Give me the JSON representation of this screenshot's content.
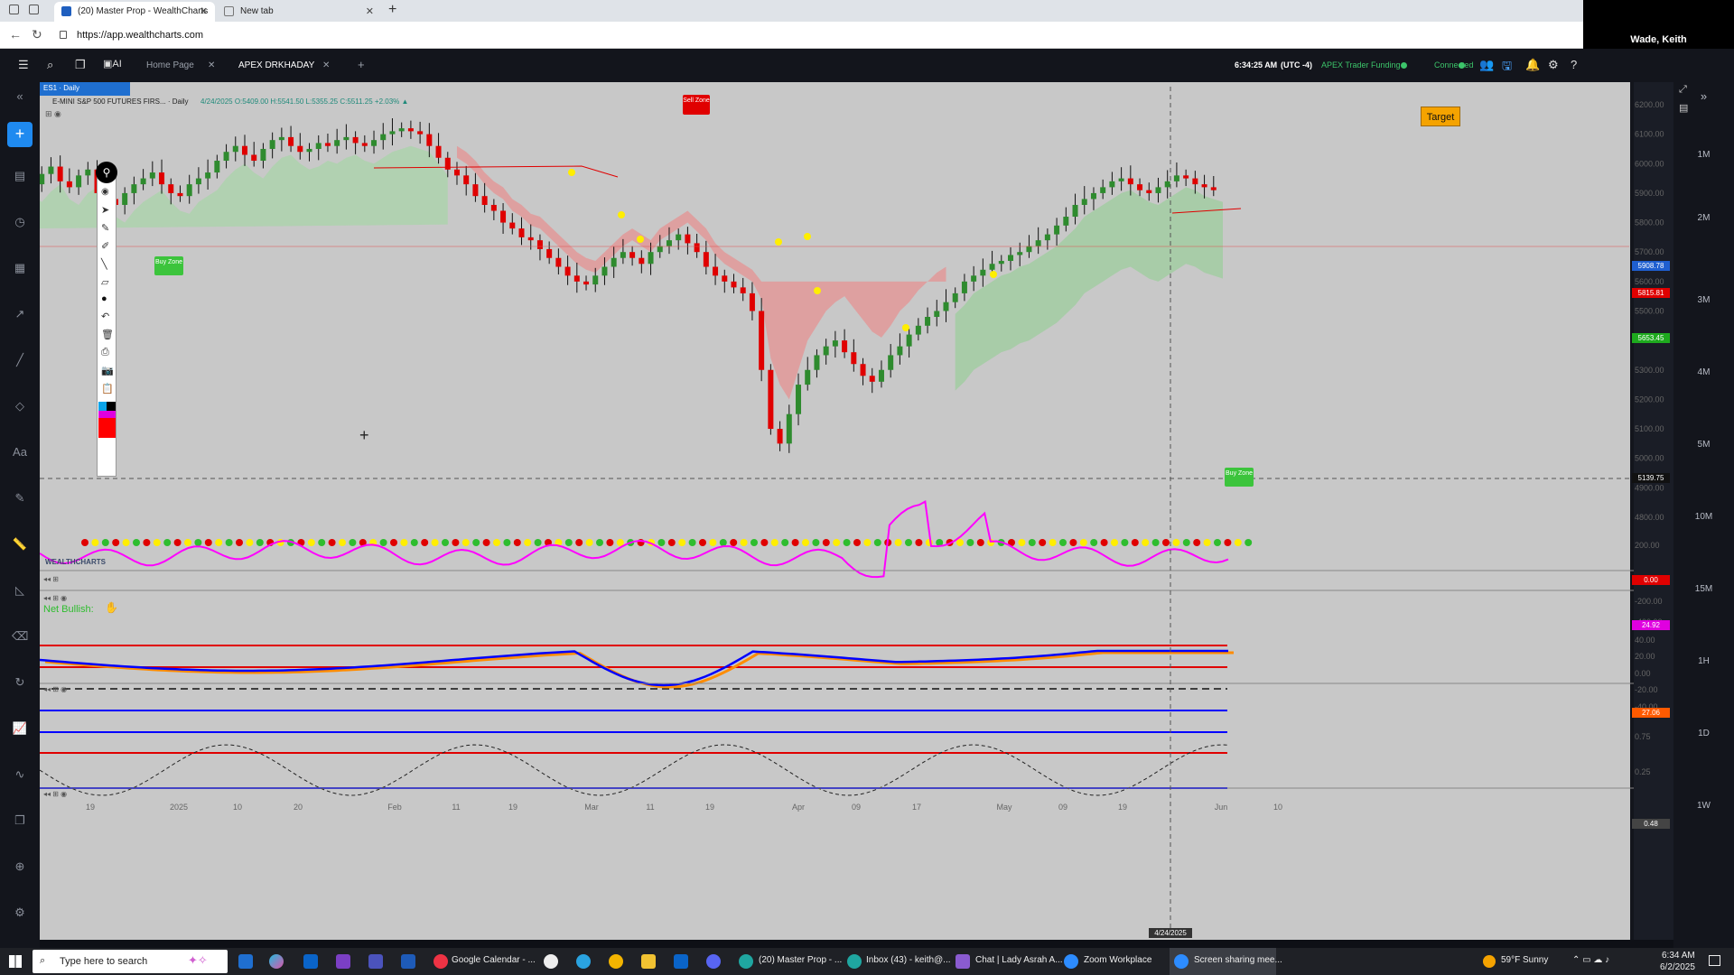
{
  "browser": {
    "tabs": [
      {
        "label": "(20) Master Prop - WealthCharts"
      },
      {
        "label": "New tab"
      }
    ],
    "url": "https://app.wealthcharts.com"
  },
  "zoom": {
    "participant": "Wade, Keith"
  },
  "app": {
    "tabs": [
      {
        "label": "Home Page"
      },
      {
        "label": "APEX DRKHADAY"
      }
    ],
    "clock": "6:34:25 AM",
    "timezone": "(UTC -4)",
    "account": "APEX Trader Funding",
    "connection": "Connected",
    "right_timeframes": [
      "1M",
      "2M",
      "3M",
      "4M",
      "5M",
      "10M",
      "15M",
      "1H",
      "1D",
      "1W"
    ]
  },
  "chart": {
    "symbol_badge": "ES1 · Daily",
    "instrument": "E-MINI S&P 500 FUTURES FIRS... · Daily",
    "ohlc": "4/24/2025 O:5409.00 H:5541.50 L:5355.25 C:5511.25 +2.03% ▲",
    "sell_zone_label": "Sell Zone",
    "buy_zone_label": "Buy Zone",
    "target_label": "Target",
    "logo": "WEALTHCHARTS",
    "net_label": "Net Bullish:",
    "price_axis": [
      "6200.00",
      "6100.00",
      "6000.00",
      "5900.00",
      "5800.00",
      "5700.00",
      "5600.00",
      "5500.00",
      "5400.00",
      "5300.00",
      "5200.00",
      "5100.00",
      "5000.00",
      "4900.00",
      "4800.00"
    ],
    "price_tags": {
      "last": "5908.78",
      "red": "5815.81",
      "green": "5653.45",
      "crosshair": "5139.75"
    },
    "dots_value": "0.00",
    "osc_axis": [
      "200.00",
      "-200.00",
      "-400.00"
    ],
    "osc_value": "24.92",
    "stoch_axis": [
      "40.00",
      "20.00",
      "0.00",
      "-20.00",
      "-40.00"
    ],
    "stoch_value": "27.06",
    "cycle_axis": [
      "0.75",
      "0.25"
    ],
    "cycle_value": "0.48",
    "x_axis": [
      "19",
      "2025",
      "10",
      "20",
      "Feb",
      "11",
      "19",
      "Mar",
      "11",
      "19",
      "Apr",
      "09",
      "17",
      "4/24/2025",
      "May",
      "09",
      "19",
      "Jun",
      "10"
    ],
    "colors": {
      "bull": "#2e8b2e",
      "bear": "#e00000",
      "osc": "#ff00ff",
      "stoch_a": "#0000ff",
      "stoch_b": "#ff8c00"
    }
  },
  "taskbar": {
    "search_placeholder": "Type here to search",
    "apps": [
      "Google Calendar - ...",
      "(20) Master Prop - ...",
      "Inbox (43) - keith@...",
      "Chat | Lady Asrah A...",
      "Zoom Workplace",
      "Screen sharing mee..."
    ],
    "weather": "59°F  Sunny",
    "time": "6:34 AM",
    "date": "6/2/2025"
  }
}
